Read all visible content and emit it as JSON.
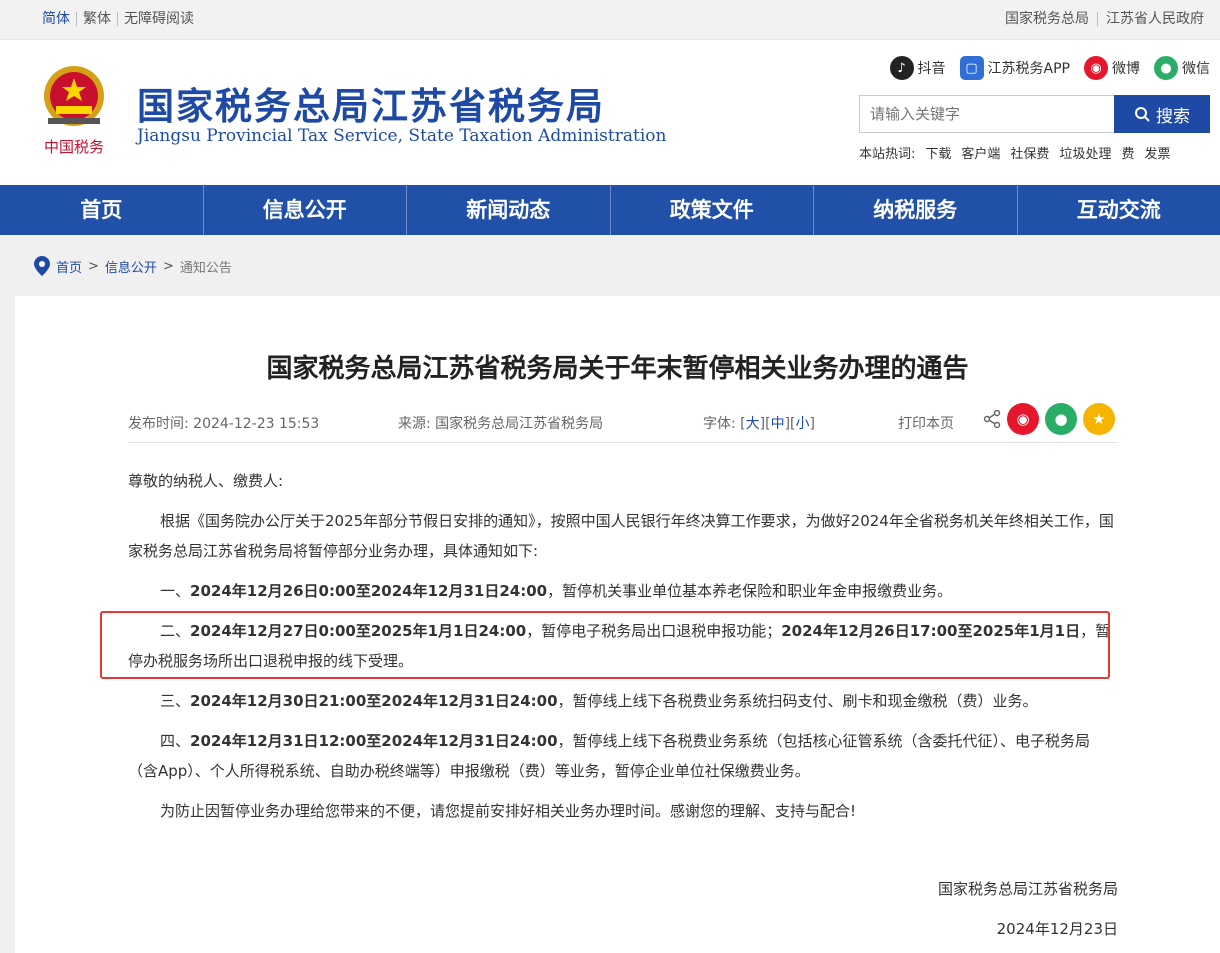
{
  "topbar": {
    "left": [
      "简体",
      "繁体",
      "无障碍阅读"
    ],
    "right": [
      "国家税务总局",
      "江苏省人民政府"
    ]
  },
  "header": {
    "emblem_text": "中国税务",
    "title": "国家税务总局江苏省税务局",
    "subtitle": "Jiangsu Provincial Tax Service, State Taxation Administration",
    "social": [
      {
        "label": "抖音",
        "icon": "douyin-icon",
        "color": "#222222"
      },
      {
        "label": "江苏税务APP",
        "icon": "app-icon",
        "color": "#2f6fd6"
      },
      {
        "label": "微博",
        "icon": "weibo-icon",
        "color": "#e6162d"
      },
      {
        "label": "微信",
        "icon": "wechat-icon",
        "color": "#2aae67"
      }
    ],
    "search": {
      "placeholder": "请输入关键字",
      "button": "搜索"
    },
    "hot_label": "本站热词:",
    "hot_words": [
      "下载",
      "客户端",
      "社保费",
      "垃圾处理",
      "费",
      "发票"
    ]
  },
  "nav": [
    "首页",
    "信息公开",
    "新闻动态",
    "政策文件",
    "纳税服务",
    "互动交流"
  ],
  "breadcrumb": {
    "home": "首页",
    "sep": ">",
    "section": "信息公开",
    "current": "通知公告"
  },
  "article": {
    "title": "国家税务总局江苏省税务局关于年末暂停相关业务办理的通告",
    "publish": "发布时间: 2024-12-23 15:53",
    "source": "来源: 国家税务总局江苏省税务局",
    "font_label": "字体:",
    "font_sizes": [
      "大",
      "中",
      "小"
    ],
    "print": "打印本页",
    "greeting": "尊敬的纳税人、缴费人:",
    "p_intro": "根据《国务院办公厅关于2025年部分节假日安排的通知》，按照中国人民银行年终决算工作要求，为做好2024年全省税务机关年终相关工作，国家税务总局江苏省税务局将暂停部分业务办理，具体通知如下:",
    "p1_prefix": "一、",
    "p1_bold": "2024年12月26日0:00至2024年12月31日24:00",
    "p1_rest": "，暂停机关事业单位基本养老保险和职业年金申报缴费业务。",
    "p2_prefix": "二、",
    "p2_bold1": "2024年12月27日0:00至2025年1月1日24:00",
    "p2_mid": "，暂停电子税务局出口退税申报功能；",
    "p2_bold2": "2024年12月26日17:00至2025年1月1日",
    "p2_rest": "，暂停办税服务场所出口退税申报的线下受理。",
    "p3_prefix": "三、",
    "p3_bold": "2024年12月30日21:00至2024年12月31日24:00",
    "p3_rest": "，暂停线上线下各税费业务系统扫码支付、刷卡和现金缴税（费）业务。",
    "p4_prefix": "四、",
    "p4_bold": "2024年12月31日12:00至2024年12月31日24:00",
    "p4_rest": "，暂停线上线下各税费业务系统（包括核心征管系统（含委托代征）、电子税务局（含App）、个人所得税系统、自助办税终端等）申报缴税（费）等业务，暂停企业单位社保缴费业务。",
    "p_close": "为防止因暂停业务办理给您带来的不便，请您提前安排好相关业务办理时间。感谢您的理解、支持与配合!",
    "signature": "国家税务总局江苏省税务局",
    "date": "2024年12月23日"
  }
}
